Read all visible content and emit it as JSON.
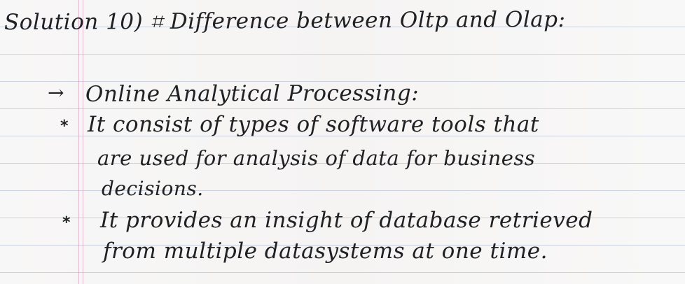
{
  "document": {
    "title": "Solution 10) ⌗ Difference between Oltp and Olap:",
    "section_arrow": "→",
    "section_heading": "Online Analytical Processing:",
    "bullet_symbol": "*",
    "bullets": [
      {
        "lines": [
          "It consist of types of software tools that",
          "are used for analysis of data for business",
          "decisions."
        ]
      },
      {
        "lines": [
          "It provides an insight of database retrieved",
          "from multiple datasystems at one time."
        ]
      }
    ]
  }
}
